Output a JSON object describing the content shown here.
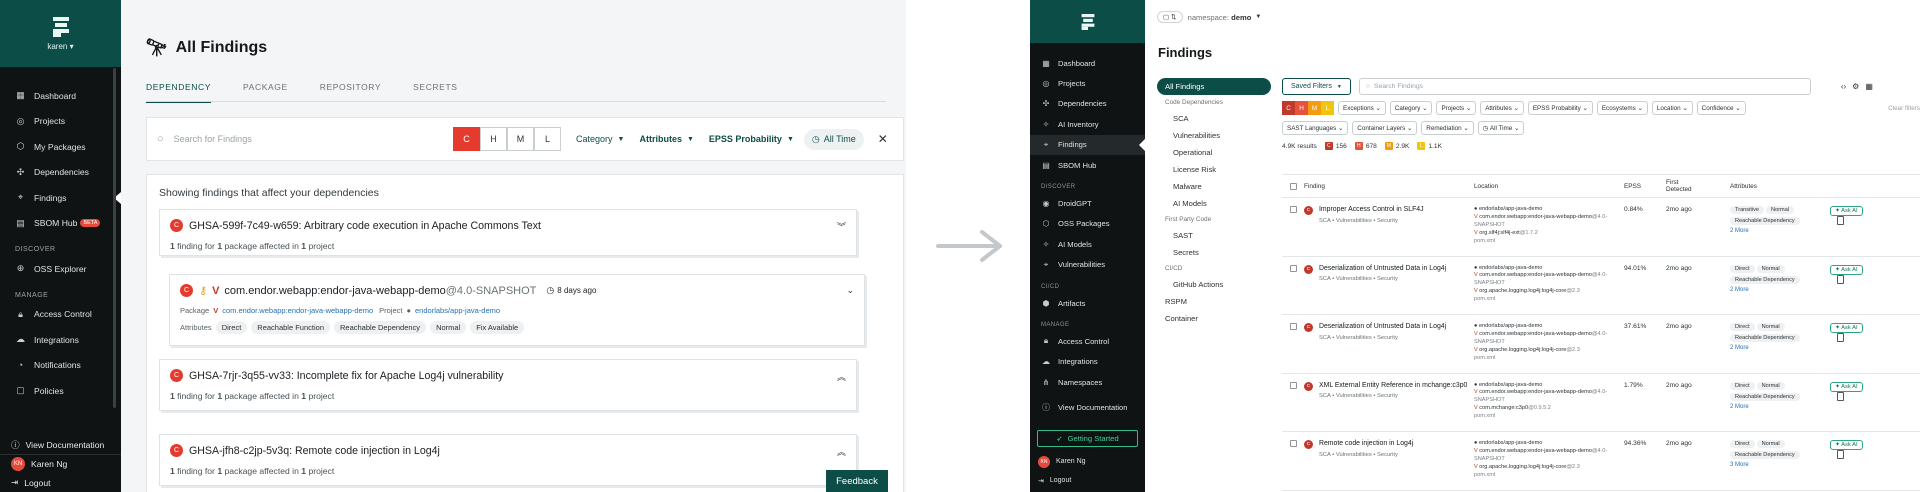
{
  "left": {
    "sidebar": {
      "user": "karen",
      "items": [
        {
          "label": "Dashboard",
          "icon": "speedometer-icon"
        },
        {
          "label": "Projects",
          "icon": "projects-icon"
        },
        {
          "label": "My Packages",
          "icon": "package-icon"
        },
        {
          "label": "Dependencies",
          "icon": "dependencies-icon"
        },
        {
          "label": "Findings",
          "icon": "telescope-icon"
        },
        {
          "label": "SBOM Hub",
          "icon": "sbom-icon",
          "badge": "BETA"
        }
      ],
      "discover_label": "DISCOVER",
      "discover_items": [
        {
          "label": "OSS Explorer",
          "icon": "globe-icon"
        }
      ],
      "manage_label": "MANAGE",
      "manage_items": [
        {
          "label": "Access Control",
          "icon": "lock-icon"
        },
        {
          "label": "Integrations",
          "icon": "integrations-icon"
        },
        {
          "label": "Notifications",
          "icon": "bell-icon"
        },
        {
          "label": "Policies",
          "icon": "policy-icon"
        }
      ],
      "view_docs": "View Documentation",
      "user_name": "Karen Ng",
      "user_initials": "KN",
      "logout": "Logout"
    },
    "main": {
      "title": "All Findings",
      "tabs": [
        "DEPENDENCY",
        "PACKAGE",
        "REPOSITORY",
        "SECRETS"
      ],
      "search_placeholder": "Search for Findings",
      "severity": [
        "C",
        "H",
        "M",
        "L"
      ],
      "filters": {
        "category": "Category",
        "attributes": "Attributes",
        "epss": "EPSS Probability",
        "all_time": "All Time"
      },
      "results_heading": "Showing findings that affect your dependencies",
      "cards": [
        {
          "title": "GHSA-599f-7c49-w659: Arbitrary code execution in Apache Commons Text",
          "n1": "1",
          "t1": "finding for",
          "n2": "1",
          "t2": "package affected in",
          "n3": "1",
          "t3": "project"
        },
        {
          "title": "GHSA-7rjr-3q55-vv33: Incomplete fix for Apache Log4j vulnerability",
          "n1": "1",
          "t1": "finding for",
          "n2": "1",
          "t2": "package affected in",
          "n3": "1",
          "t3": "project"
        },
        {
          "title": "GHSA-jfh8-c2jp-5v3q: Remote code injection in Log4j",
          "n1": "1",
          "t1": "finding for",
          "n2": "1",
          "t2": "package affected in",
          "n3": "1",
          "t3": "project"
        }
      ],
      "package_card": {
        "name": "com.endor.webapp:endor-java-webapp-demo",
        "version": "@4.0-SNAPSHOT",
        "age": "8 days ago",
        "package_label": "Package",
        "package_value": "com.endor.webapp:endor-java-webapp-demo",
        "project_label": "Project",
        "project_value": "endorlabs/app-java-demo",
        "attributes_label": "Attributes",
        "attributes": [
          "Direct",
          "Reachable Function",
          "Reachable Dependency",
          "Normal",
          "Fix Available"
        ]
      },
      "feedback": "Feedback"
    }
  },
  "right": {
    "sidebar": {
      "items": [
        {
          "label": "Dashboard",
          "icon": "speedometer-icon"
        },
        {
          "label": "Projects",
          "icon": "projects-icon"
        },
        {
          "label": "Dependencies",
          "icon": "dependencies-icon"
        },
        {
          "label": "AI Inventory",
          "icon": "ai-icon"
        },
        {
          "label": "Findings",
          "icon": "telescope-icon"
        },
        {
          "label": "SBOM Hub",
          "icon": "sbom-icon"
        }
      ],
      "discover_label": "DISCOVER",
      "discover_items": [
        {
          "label": "DroidGPT",
          "icon": "robot-icon"
        },
        {
          "label": "OSS Packages",
          "icon": "package-icon"
        },
        {
          "label": "AI Models",
          "icon": "ai-icon"
        },
        {
          "label": "Vulnerabilities",
          "icon": "bug-icon"
        }
      ],
      "cicd_label": "CI/CD",
      "cicd_items": [
        {
          "label": "Artifacts",
          "icon": "artifact-icon"
        }
      ],
      "manage_label": "MANAGE",
      "manage_items": [
        {
          "label": "Access Control",
          "icon": "lock-icon"
        },
        {
          "label": "Integrations",
          "icon": "integrations-icon"
        },
        {
          "label": "Namespaces",
          "icon": "namespace-icon"
        }
      ],
      "view_docs": "View Documentation",
      "getting_started": "Getting Started",
      "user_name": "Karen Ng",
      "user_initials": "KN",
      "logout": "Logout"
    },
    "namespace_label": "namespace:",
    "namespace_value": "demo",
    "title": "Findings",
    "nav": {
      "all": "All Findings",
      "code_deps": "Code Dependencies",
      "code_items": [
        "SCA",
        "Vulnerabilities",
        "Operational",
        "License Risk",
        "Malware",
        "AI Models"
      ],
      "first_party": "First Party Code",
      "fp_items": [
        "SAST",
        "Secrets"
      ],
      "cicd": "CI/CD",
      "cicd_items": [
        "GitHub Actions"
      ],
      "rspm": "RSPM",
      "container": "Container"
    },
    "saved_filters": "Saved Filters",
    "search_placeholder": "Search Findings",
    "severity": [
      "C",
      "H",
      "M",
      "L"
    ],
    "filter_chips_row1": [
      "Exceptions",
      "Category",
      "Projects",
      "Attributes",
      "EPSS Probability",
      "Ecosystems",
      "Location",
      "Confidence"
    ],
    "filter_chips_row2": [
      "SAST Languages",
      "Container Layers",
      "Remediation",
      "All Time"
    ],
    "clear_filters": "Clear filters",
    "results_count": "4.9K results",
    "counts": [
      {
        "k": "C",
        "v": "156",
        "color": "#c0392b"
      },
      {
        "k": "H",
        "v": "678",
        "color": "#e5533d"
      },
      {
        "k": "M",
        "v": "2.9K",
        "color": "#f39c12"
      },
      {
        "k": "L",
        "v": "1.1K",
        "color": "#f1c40f"
      }
    ],
    "columns": [
      "Finding",
      "Location",
      "EPSS",
      "First Detected",
      "Attributes"
    ],
    "rows": [
      {
        "title": "Improper Access Control in SLF4J",
        "sub": "SCA • Vulnerabilities • Security",
        "loc": [
          "endorlabs/app-java-demo",
          "com.endor.webapp:endor-java-webapp-demo",
          "@4.0-SNAPSHOT",
          "org.slf4j:slf4j-ext",
          "@1.7.2",
          "pom.xml"
        ],
        "epss": "0.84%",
        "detected": "2mo ago",
        "attrs": [
          "Transitive",
          "Normal",
          "Reachable Dependency"
        ],
        "more": "2 More"
      },
      {
        "title": "Deserialization of Untrusted Data in Log4j",
        "sub": "SCA • Vulnerabilities • Security",
        "loc": [
          "endorlabs/app-java-demo",
          "com.endor.webapp:endor-java-webapp-demo",
          "@4.0-SNAPSHOT",
          "org.apache.logging.log4j:log4j-core",
          "@2.3",
          "pom.xml"
        ],
        "epss": "94.01%",
        "detected": "2mo ago",
        "attrs": [
          "Direct",
          "Normal",
          "Reachable Dependency"
        ],
        "more": "2 More"
      },
      {
        "title": "Deserialization of Untrusted Data in Log4j",
        "sub": "SCA • Vulnerabilities • Security",
        "loc": [
          "endorlabs/app-java-demo",
          "com.endor.webapp:endor-java-webapp-demo",
          "@4.0-SNAPSHOT",
          "org.apache.logging.log4j:log4j-core",
          "@2.3",
          "pom.xml"
        ],
        "epss": "37.61%",
        "detected": "2mo ago",
        "attrs": [
          "Direct",
          "Normal",
          "Reachable Dependency"
        ],
        "more": "2 More"
      },
      {
        "title": "XML External Entity Reference in mchange:c3p0",
        "sub": "SCA • Vulnerabilities • Security",
        "loc": [
          "endorlabs/app-java-demo",
          "com.endor.webapp:endor-java-webapp-demo",
          "@4.0-SNAPSHOT",
          "com.mchange:c3p0",
          "@0.9.5.2",
          "pom.xml"
        ],
        "epss": "1.79%",
        "detected": "2mo ago",
        "attrs": [
          "Direct",
          "Normal",
          "Reachable Dependency"
        ],
        "more": "2 More"
      },
      {
        "title": "Remote code injection in Log4j",
        "sub": "SCA • Vulnerabilities • Security",
        "loc": [
          "endorlabs/app-java-demo",
          "com.endor.webapp:endor-java-webapp-demo",
          "@4.0-SNAPSHOT",
          "org.apache.logging.log4j:log4j-core",
          "@2.3",
          "pom.xml"
        ],
        "epss": "94.36%",
        "detected": "2mo ago",
        "attrs": [
          "Direct",
          "Normal",
          "Reachable Dependency"
        ],
        "more": "3 More"
      }
    ],
    "ask_ai": "Ask AI"
  },
  "colors": {
    "brand": "#0d4d47",
    "sidebar": "#101314",
    "critical": "#e53b2f"
  }
}
